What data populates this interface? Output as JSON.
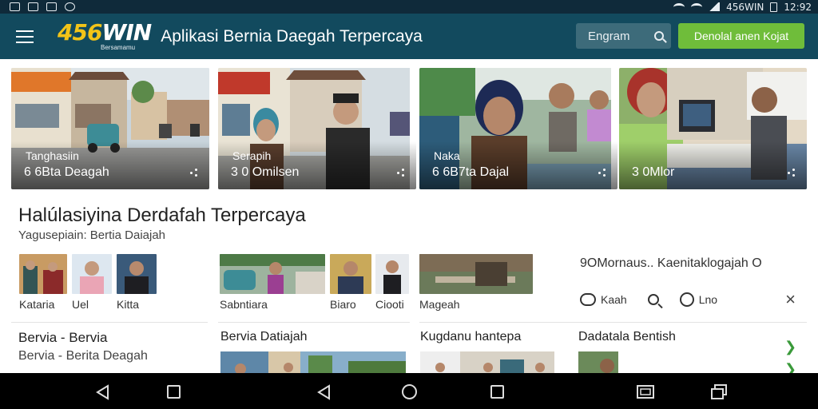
{
  "status_bar": {
    "left_icons": [
      "image-icon",
      "gallery-icon",
      "file-icon",
      "app-icon"
    ],
    "carrier_text": "456WIN",
    "time": "12:92"
  },
  "header": {
    "logo_number": "456",
    "logo_word": "WIN",
    "logo_tagline": "Bersamamu",
    "title": "Aplikasi Bernia Daegah Terpercaya",
    "search_label": "Engram",
    "cta_label": "Denolal anen Kojat"
  },
  "cards": [
    {
      "caption_top": "Tanghasiin",
      "caption_bottom": "6 6Bta Deagah"
    },
    {
      "caption_top": "Serapih",
      "caption_bottom": "3 0 Omilsen"
    },
    {
      "caption_top": "Naka",
      "caption_bottom": "6 6B7ta Dajal"
    },
    {
      "caption_top": "",
      "caption_bottom": "3 0Mlor"
    }
  ],
  "section": {
    "title": "Halúlasiyina Derdafah Terpercaya",
    "subtitle": "Yagusepiain: Bertia Daiajah"
  },
  "thumbs": [
    {
      "label": "Kataria"
    },
    {
      "label": "Uel"
    },
    {
      "label": "Kitta"
    },
    {
      "label": "Sabntiara"
    },
    {
      "label": "Biaro"
    },
    {
      "label": "Ciooti"
    },
    {
      "label": "Mageah"
    }
  ],
  "right_panel": {
    "title": "9OMornaus.. Kaenitaklogajah O",
    "actions": [
      {
        "icon": "chat-icon",
        "label": "Kaah"
      },
      {
        "icon": "search-icon",
        "label": ""
      },
      {
        "icon": "circle-icon",
        "label": "Lno"
      }
    ],
    "close": "×"
  },
  "list": [
    {
      "title": "Bervia - Bervia",
      "subtitle": "Bervia - Berita Deagah"
    },
    {
      "title": "Bervia Datiajah"
    },
    {
      "title": "Kugdanu hantepa"
    },
    {
      "title": "Dadatala Bentish"
    }
  ],
  "colors": {
    "header_bg": "#124a5e",
    "cta_bg": "#6fbd3a",
    "logo_yellow": "#f2c418",
    "chevron": "#3a9a3a"
  }
}
